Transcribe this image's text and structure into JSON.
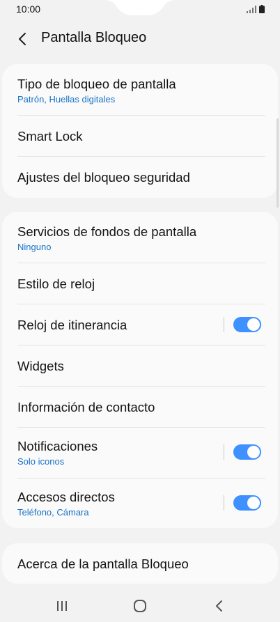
{
  "status_bar": {
    "time": "10:00",
    "icons": [
      "signal-icon",
      "battery-icon"
    ]
  },
  "header": {
    "title": "Pantalla Bloqueo",
    "back_icon": "back-arrow-icon"
  },
  "group1": {
    "items": [
      {
        "title": "Tipo de bloqueo de pantalla",
        "subtitle": "Patrón, Huellas digitales"
      },
      {
        "title": "Smart Lock"
      },
      {
        "title": "Ajustes del bloqueo seguridad"
      }
    ]
  },
  "group2": {
    "items": [
      {
        "title": "Servicios de fondos de pantalla",
        "subtitle": "Ninguno"
      },
      {
        "title": "Estilo de reloj"
      },
      {
        "title": "Reloj de itinerancia",
        "toggle": true
      },
      {
        "title": "Widgets"
      },
      {
        "title": "Información de contacto"
      },
      {
        "title": "Notificaciones",
        "subtitle": "Solo iconos",
        "toggle": true
      },
      {
        "title": "Accesos directos",
        "subtitle": "Teléfono, Cámara",
        "toggle": true
      }
    ]
  },
  "group3": {
    "items": [
      {
        "title": "Acerca de la pantalla Bloqueo"
      }
    ]
  },
  "navbar": {
    "icons": [
      "recent-apps-icon",
      "home-icon",
      "back-icon"
    ]
  },
  "colors": {
    "accent": "#3e91ff",
    "subtitle": "#1a73c6",
    "background": "#f2f2f2",
    "card": "#fafafa"
  }
}
